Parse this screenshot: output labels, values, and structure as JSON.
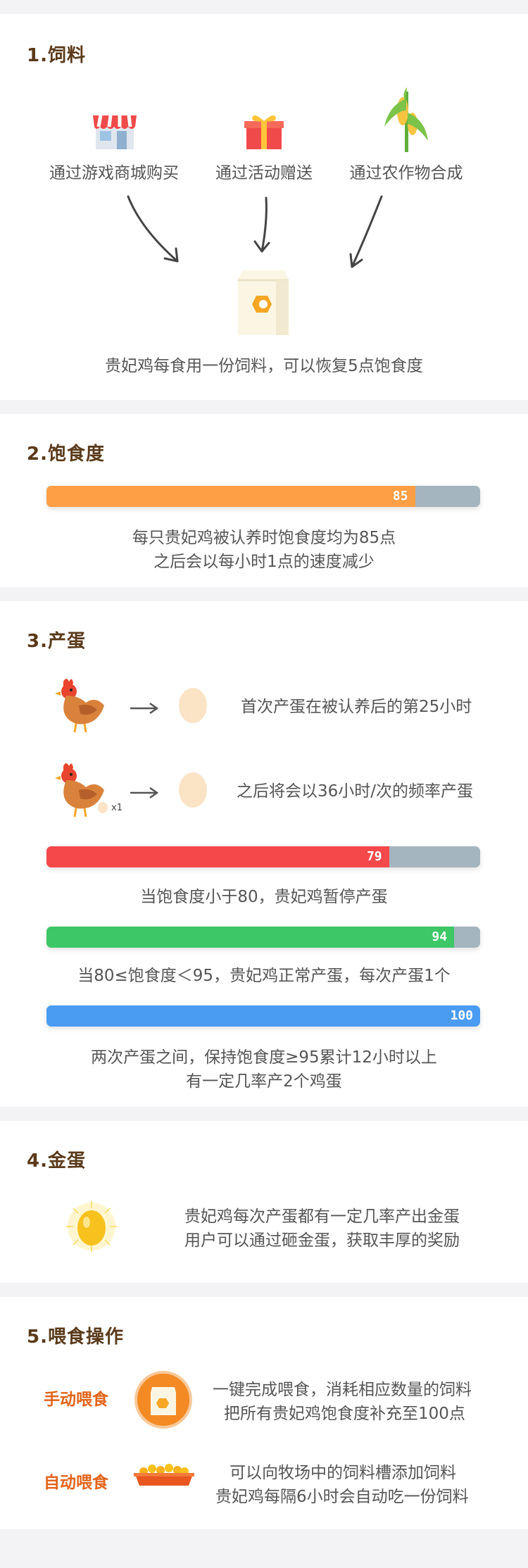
{
  "sections": {
    "feed": {
      "title": "1.饲料",
      "sources": [
        "通过游戏商城购买",
        "通过活动赠送",
        "通过农作物合成"
      ],
      "note": "贵妃鸡每食用一份饲料，可以恢复5点饱食度"
    },
    "satiety": {
      "title": "2.饱食度",
      "bar": {
        "value": 85,
        "label": "85",
        "color": "#ff9f45"
      },
      "lines": [
        "每只贵妃鸡被认养时饱食度均为85点",
        "之后会以每小时1点的速度减少"
      ]
    },
    "eggs": {
      "title": "3.产蛋",
      "rows": [
        {
          "text": "首次产蛋在被认养后的第25小时"
        },
        {
          "text": "之后将会以36小时/次的频率产蛋",
          "badge": "x1"
        }
      ],
      "bars": [
        {
          "value": 79,
          "label": "79",
          "color": "#f5484b",
          "caption": [
            "当饱食度小于80，贵妃鸡暂停产蛋"
          ]
        },
        {
          "value": 94,
          "label": "94",
          "color": "#3dc767",
          "caption": [
            "当80≤饱食度＜95，贵妃鸡正常产蛋，每次产蛋1个"
          ]
        },
        {
          "value": 100,
          "label": "100",
          "color": "#4a9cf3",
          "caption": [
            "两次产蛋之间，保持饱食度≥95累计12小时以上",
            "有一定几率产2个鸡蛋"
          ]
        }
      ]
    },
    "golden": {
      "title": "4.金蛋",
      "lines": [
        "贵妃鸡每次产蛋都有一定几率产出金蛋",
        "用户可以通过砸金蛋，获取丰厚的奖励"
      ]
    },
    "feeding": {
      "title": "5.喂食操作",
      "manual": {
        "label": "手动喂食",
        "lines": [
          "一键完成喂食，消耗相应数量的饲料",
          "把所有贵妃鸡饱食度补充至100点"
        ]
      },
      "auto": {
        "label": "自动喂食",
        "lines": [
          "可以向牧场中的饲料槽添加饲料",
          "贵妃鸡每隔6小时会自动吃一份饲料"
        ]
      }
    }
  },
  "icons": {
    "shop": "shop-icon",
    "gift": "gift-icon",
    "corn": "corn-icon",
    "feed_bag": "feed-bag-icon",
    "chicken": "chicken-icon",
    "egg": "egg-icon",
    "golden_egg": "golden-egg-icon",
    "trough": "feed-trough-icon"
  }
}
